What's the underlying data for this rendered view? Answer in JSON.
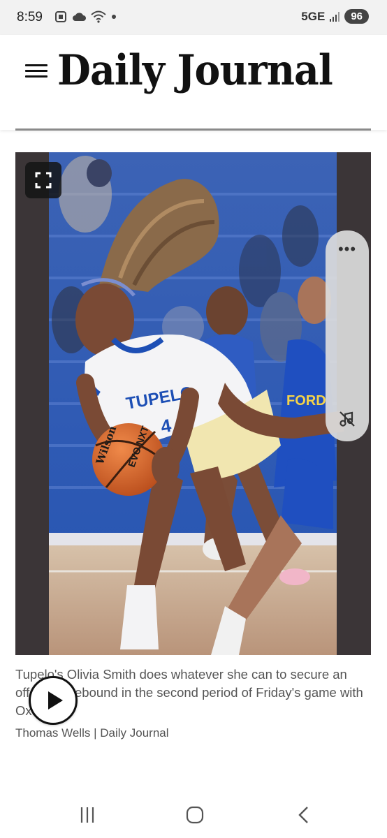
{
  "status_bar": {
    "time": "8:59",
    "network": "5GE",
    "battery": "96",
    "icons_left": [
      "screenshot-icon",
      "cloud-icon",
      "wifi-icon",
      "dot-icon"
    ],
    "icons_right": [
      "signal-icon",
      "battery-icon"
    ]
  },
  "header": {
    "masthead": "Daily Journal",
    "menu_icon": "hamburger-menu-icon"
  },
  "photo": {
    "fullscreen_icon": "fullscreen-icon",
    "menu_dots": "•••",
    "mute_icon": "music-off-icon",
    "jersey_text": "TUPELO",
    "ball_brand": "Wilson",
    "ball_model": "EVO NXT",
    "jersey_number": "4"
  },
  "caption": {
    "text": "Tupelo's Olivia Smith does whatever she can to secure an offensive rebound in the second period of Friday's game with Oxford.",
    "credit": "Thomas Wells | Daily Journal"
  },
  "overlay": {
    "play_icon": "play-icon"
  },
  "nav_bar": {
    "buttons": [
      "recent-apps-icon",
      "home-icon",
      "back-icon"
    ]
  },
  "colors": {
    "status_bg": "#f2f2f2",
    "bleacher_blue": "#2e5fb8",
    "court": "#c9a98a",
    "jersey_white": "#f4f4f6",
    "jersey_blue": "#1d4fb5",
    "ball_orange": "#d9662b"
  }
}
